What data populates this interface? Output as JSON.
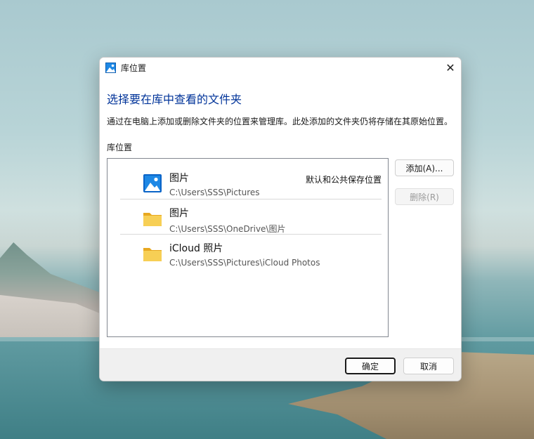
{
  "window": {
    "title": "库位置",
    "close_glyph": "✕"
  },
  "heading": "选择要在库中查看的文件夹",
  "description": "通过在电脑上添加或删除文件夹的位置来管理库。此处添加的文件夹仍将存储在其原始位置。",
  "section_label": "库位置",
  "locations": [
    {
      "name": "图片",
      "path": "C:\\Users\\SSS\\Pictures",
      "badge": "默认和公共保存位置",
      "icon": "pictures-library-icon"
    },
    {
      "name": "图片",
      "path": "C:\\Users\\SSS\\OneDrive\\图片",
      "badge": "",
      "icon": "folder-icon"
    },
    {
      "name": "iCloud 照片",
      "path": "C:\\Users\\SSS\\Pictures\\iCloud Photos",
      "badge": "",
      "icon": "folder-icon"
    }
  ],
  "buttons": {
    "add": "添加(A)...",
    "remove": "删除(R)",
    "ok": "确定",
    "cancel": "取消"
  },
  "colors": {
    "heading": "#003399",
    "folder": "#f4c542",
    "picture_icon": "#0a64c8"
  }
}
